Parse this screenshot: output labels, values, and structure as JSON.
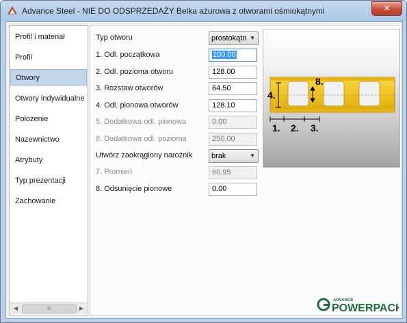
{
  "window": {
    "title": "Advance Steel - NIE DO ODSPRZEDAŻY   Belka ażurowa z otworami ośmiokątnymi",
    "close_glyph": "✕"
  },
  "nav": {
    "items": [
      {
        "label": "Profil i materiał"
      },
      {
        "label": "Profil"
      },
      {
        "label": "Otwory"
      },
      {
        "label": "Otwory indywidualne"
      },
      {
        "label": "Położenie"
      },
      {
        "label": "Nazewnictwo"
      },
      {
        "label": "Atrybuty"
      },
      {
        "label": "Typ prezentacji"
      },
      {
        "label": "Zachowanie"
      }
    ],
    "selected": "Otwory",
    "scroll_left": "◀",
    "scroll_right": "▶",
    "scroll_grip": "III"
  },
  "form": {
    "hole_type": {
      "label": "Typ otworu",
      "value": "prostokątn"
    },
    "start_dist": {
      "label": "1. Odl. początkowa",
      "value": "100.00"
    },
    "hor_dist": {
      "label": "2. Odl. pozioma otworu",
      "value": "128.00"
    },
    "spacing": {
      "label": "3. Rozstaw otworów",
      "value": "64.50"
    },
    "vert_dist": {
      "label": "4. Odl. pionowa otworów",
      "value": "128.10"
    },
    "extra_vert": {
      "label": "5. Dodatkowa odl. pionowa",
      "value": "0.00"
    },
    "extra_hor": {
      "label": "6. Dodatkowa odl. pozioma",
      "value": "250.00"
    },
    "rounded_corner": {
      "label": "Utwórz zaokrąglony narożnik",
      "value": "brak"
    },
    "radius": {
      "label": "7. Promień",
      "value": "60.95"
    },
    "vert_offset": {
      "label": "8. Odsunięcie pionowe",
      "value": "0.00"
    },
    "caret": "▼"
  },
  "preview": {
    "labels": {
      "l1": "1.",
      "l2": "2.",
      "l3": "3.",
      "l4": "4.",
      "l8": "8."
    },
    "beam_color": "#f2c21f"
  },
  "branding": {
    "small": "ADVANCE",
    "big": "POWERPACK",
    "color": "#1f6b3a"
  }
}
